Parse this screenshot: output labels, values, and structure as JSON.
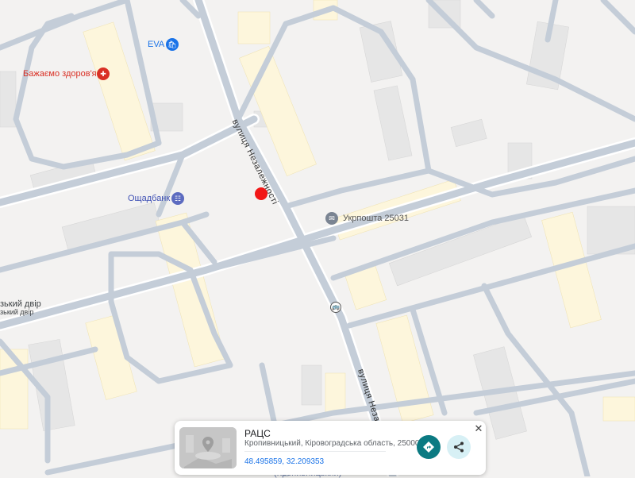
{
  "map": {
    "colors": {
      "background": "#f3f2f1",
      "road": "#c4cdd8",
      "road_edge": "#ffffff",
      "building": "#e6e6e6",
      "building_yellow": "#fdf6dc",
      "marker": "#f21717"
    },
    "pois": [
      {
        "name": "eva",
        "label": "EVA",
        "icon": "shopping-bag-icon",
        "color": "#1a73e8"
      },
      {
        "name": "pharmacy",
        "label": "Бажаємо здоров'я",
        "icon": "pharmacy-icon",
        "color": "#d93025"
      },
      {
        "name": "oschadbank",
        "label": "Ощадбанк",
        "icon": "bank-icon",
        "color": "#5c6bc0"
      },
      {
        "name": "ukrposhta",
        "label": "Укрпошта 25031",
        "icon": "mail-icon",
        "color": "#7a8492"
      },
      {
        "name": "dvir-top",
        "label": "зький двір",
        "icon": "",
        "color": "#3c4043"
      },
      {
        "name": "dvir-bottom",
        "label": "зький двір",
        "icon": "",
        "color": "#3c4043"
      }
    ],
    "streets": [
      {
        "name": "street-nezalezhnosti-north",
        "label": "вулиця Незалежності"
      },
      {
        "name": "street-nezalezhnosti-south",
        "label": "вулиця Неза"
      }
    ],
    "transit_icon": "bus-stop-icon",
    "marker_icon": "red-location-marker"
  },
  "place_card": {
    "title": "РАЦС",
    "address": "Кропивницький, Кіровоградська область, 25000",
    "coordinates": "48.495859, 32.209353",
    "thumbnail_icon": "place-photo-placeholder-icon",
    "directions_icon": "directions-icon",
    "share_icon": "share-icon",
    "close_icon": "close-icon"
  },
  "bottom_label": "(Кропивницький)"
}
